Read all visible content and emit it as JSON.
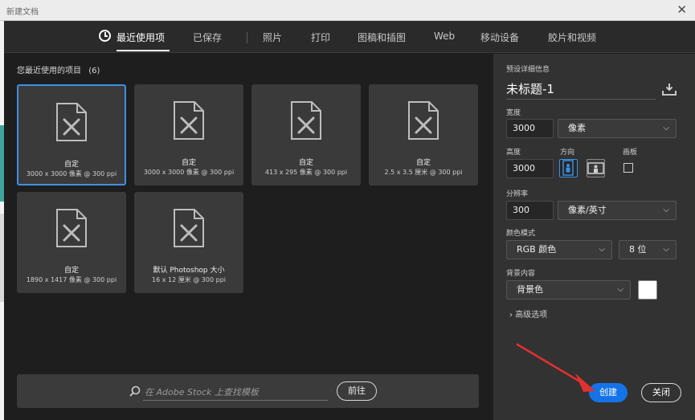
{
  "window": {
    "title": "新建文档",
    "close_glyph": "✕"
  },
  "nav": {
    "tabs": [
      {
        "label": "最近使用项",
        "active": true
      },
      {
        "label": "已保存"
      },
      {
        "label": "照片"
      },
      {
        "label": "打印"
      },
      {
        "label": "图稿和插图"
      },
      {
        "label": "Web"
      },
      {
        "label": "移动设备"
      },
      {
        "label": "胶片和视频"
      }
    ]
  },
  "recent": {
    "heading": "您最近使用的项目",
    "count": "(6)",
    "items": [
      {
        "name": "自定",
        "dims": "3000 x 3000 像素 @ 300 ppi"
      },
      {
        "name": "自定",
        "dims": "3000 x 3000 像素 @ 300 ppi"
      },
      {
        "name": "自定",
        "dims": "413 x 295 像素 @ 300 ppi"
      },
      {
        "name": "自定",
        "dims": "2.5 x 3.5 厘米 @ 300 ppi"
      },
      {
        "name": "自定",
        "dims": "1890 x 1417 像素 @ 300 ppi"
      },
      {
        "name": "默认 Photoshop 大小",
        "dims": "16 x 12 厘米 @ 300 ppi"
      }
    ]
  },
  "search": {
    "placeholder": "在 Adobe Stock 上查找模板",
    "go_label": "前往"
  },
  "preset": {
    "section_label": "预设详细信息",
    "doc_name": "未标题-1",
    "width_label": "宽度",
    "width_value": "3000",
    "width_unit": "像素",
    "height_label": "高度",
    "height_value": "3000",
    "orientation_label": "方向",
    "artboard_label": "画板",
    "resolution_label": "分辨率",
    "resolution_value": "300",
    "resolution_unit": "像素/英寸",
    "color_mode_label": "颜色模式",
    "color_mode_value": "RGB 颜色",
    "bit_depth_value": "8 位",
    "background_label": "背景内容",
    "background_value": "背景色",
    "background_swatch": "#ffffff",
    "advanced_label": "高级选项",
    "create_label": "创建",
    "close_label": "关闭"
  },
  "colors": {
    "accent": "#1473e6",
    "selected_border": "#3d8fe3",
    "annotation": "#e03030"
  }
}
